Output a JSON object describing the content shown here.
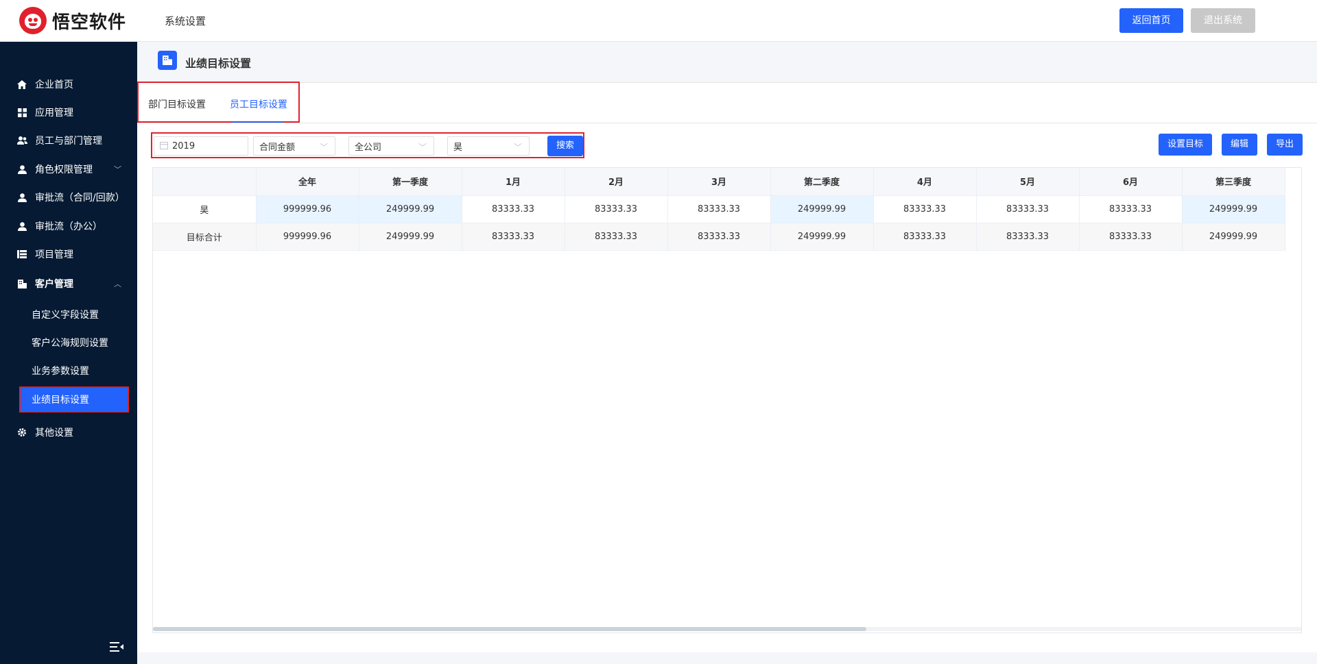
{
  "header": {
    "logo_text": "悟空软件",
    "title": "系统设置",
    "home_button": "返回首页",
    "logout_button": "退出系统",
    "colors": {
      "primary": "#2362fb",
      "disabled": "#c8c8c8",
      "brand": "#e0212d"
    }
  },
  "sidebar": {
    "items": [
      {
        "label": "企业首页",
        "icon": "home-icon"
      },
      {
        "label": "应用管理",
        "icon": "grid-icon"
      },
      {
        "label": "员工与部门管理",
        "icon": "users-icon"
      },
      {
        "label": "角色权限管理",
        "icon": "user-icon",
        "chevron": "﹀"
      },
      {
        "label": "审批流（合同/回款）",
        "icon": "user-icon"
      },
      {
        "label": "审批流（办公）",
        "icon": "user-icon"
      },
      {
        "label": "项目管理",
        "icon": "list-icon"
      },
      {
        "label": "客户管理",
        "icon": "building-icon",
        "chevron": "︿"
      },
      {
        "label": "其他设置",
        "icon": "gear-icon"
      }
    ],
    "sub_items": [
      "自定义字段设置",
      "客户公海规则设置",
      "业务参数设置",
      "业绩目标设置"
    ],
    "colors": {
      "bg": "#061a33",
      "active": "#2362fb"
    }
  },
  "page": {
    "title": "业绩目标设置",
    "tabs": [
      "部门目标设置",
      "员工目标设置"
    ],
    "filters": {
      "year": "2019",
      "metric": "合同金额",
      "scope": "全公司",
      "employee": "昊",
      "search_button": "搜索"
    },
    "actions": [
      "设置目标",
      "编辑",
      "导出"
    ]
  },
  "table": {
    "columns": [
      "",
      "全年",
      "第一季度",
      "1月",
      "2月",
      "3月",
      "第二季度",
      "4月",
      "5月",
      "6月",
      "第三季度"
    ],
    "rows": [
      {
        "name": "昊",
        "values": [
          "999999.96",
          "249999.99",
          "83333.33",
          "83333.33",
          "83333.33",
          "249999.99",
          "83333.33",
          "83333.33",
          "83333.33",
          "249999.99"
        ]
      },
      {
        "name": "目标合计",
        "values": [
          "999999.96",
          "249999.99",
          "83333.33",
          "83333.33",
          "83333.33",
          "249999.99",
          "83333.33",
          "83333.33",
          "83333.33",
          "249999.99"
        ]
      }
    ]
  }
}
